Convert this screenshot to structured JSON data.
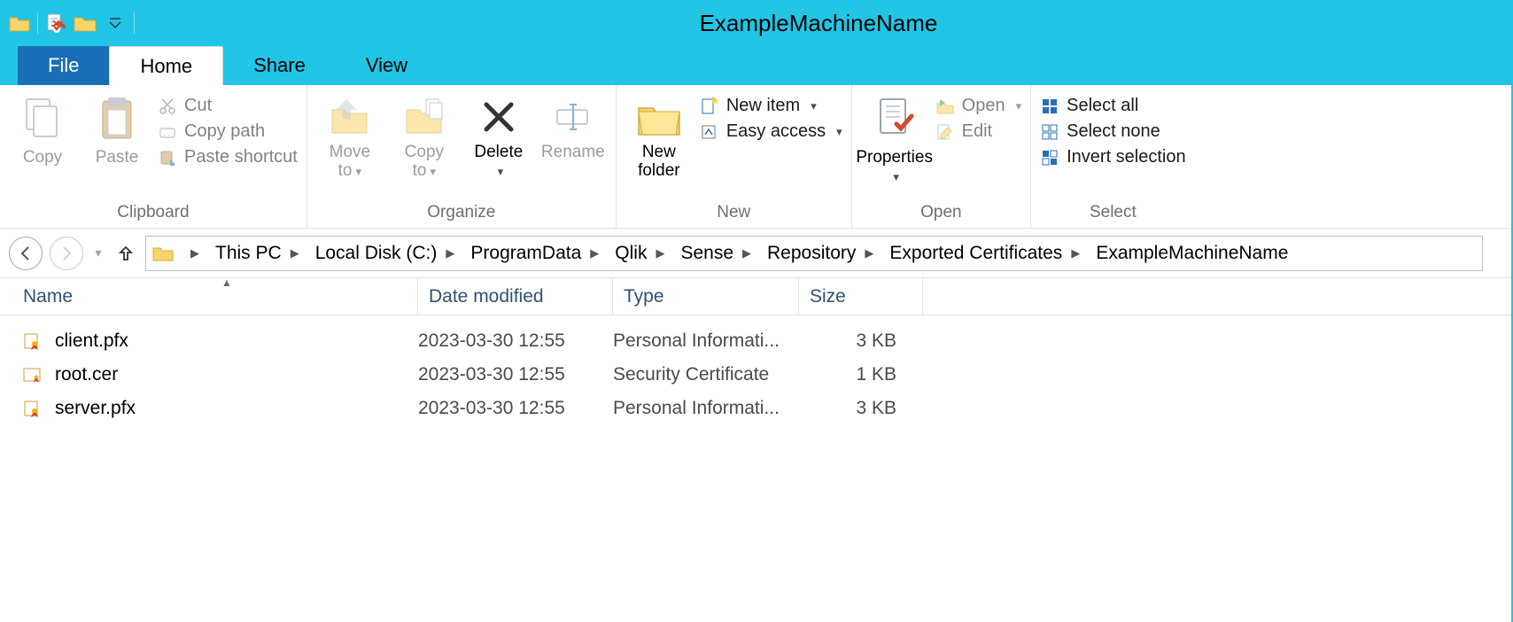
{
  "window": {
    "title": "ExampleMachineName"
  },
  "tabs": {
    "file": "File",
    "home": "Home",
    "share": "Share",
    "view": "View"
  },
  "ribbon": {
    "clipboard": {
      "label": "Clipboard",
      "copy": "Copy",
      "paste": "Paste",
      "cut": "Cut",
      "copy_path": "Copy path",
      "paste_shortcut": "Paste shortcut"
    },
    "organize": {
      "label": "Organize",
      "move_to": "Move to",
      "copy_to": "Copy to",
      "delete": "Delete",
      "rename": "Rename"
    },
    "new": {
      "label": "New",
      "new_folder": "New folder",
      "new_item": "New item",
      "easy_access": "Easy access"
    },
    "open": {
      "label": "Open",
      "properties": "Properties",
      "open": "Open",
      "edit": "Edit"
    },
    "select": {
      "label": "Select",
      "select_all": "Select all",
      "select_none": "Select none",
      "invert": "Invert selection"
    }
  },
  "breadcrumb": [
    "This PC",
    "Local Disk (C:)",
    "ProgramData",
    "Qlik",
    "Sense",
    "Repository",
    "Exported Certificates",
    "ExampleMachineName"
  ],
  "columns": {
    "name": "Name",
    "date": "Date modified",
    "type": "Type",
    "size": "Size"
  },
  "files": [
    {
      "name": "client.pfx",
      "date": "2023-03-30 12:55",
      "type": "Personal Informati...",
      "size": "3 KB",
      "icon": "pfx"
    },
    {
      "name": "root.cer",
      "date": "2023-03-30 12:55",
      "type": "Security Certificate",
      "size": "1 KB",
      "icon": "cer"
    },
    {
      "name": "server.pfx",
      "date": "2023-03-30 12:55",
      "type": "Personal Informati...",
      "size": "3 KB",
      "icon": "pfx"
    }
  ]
}
